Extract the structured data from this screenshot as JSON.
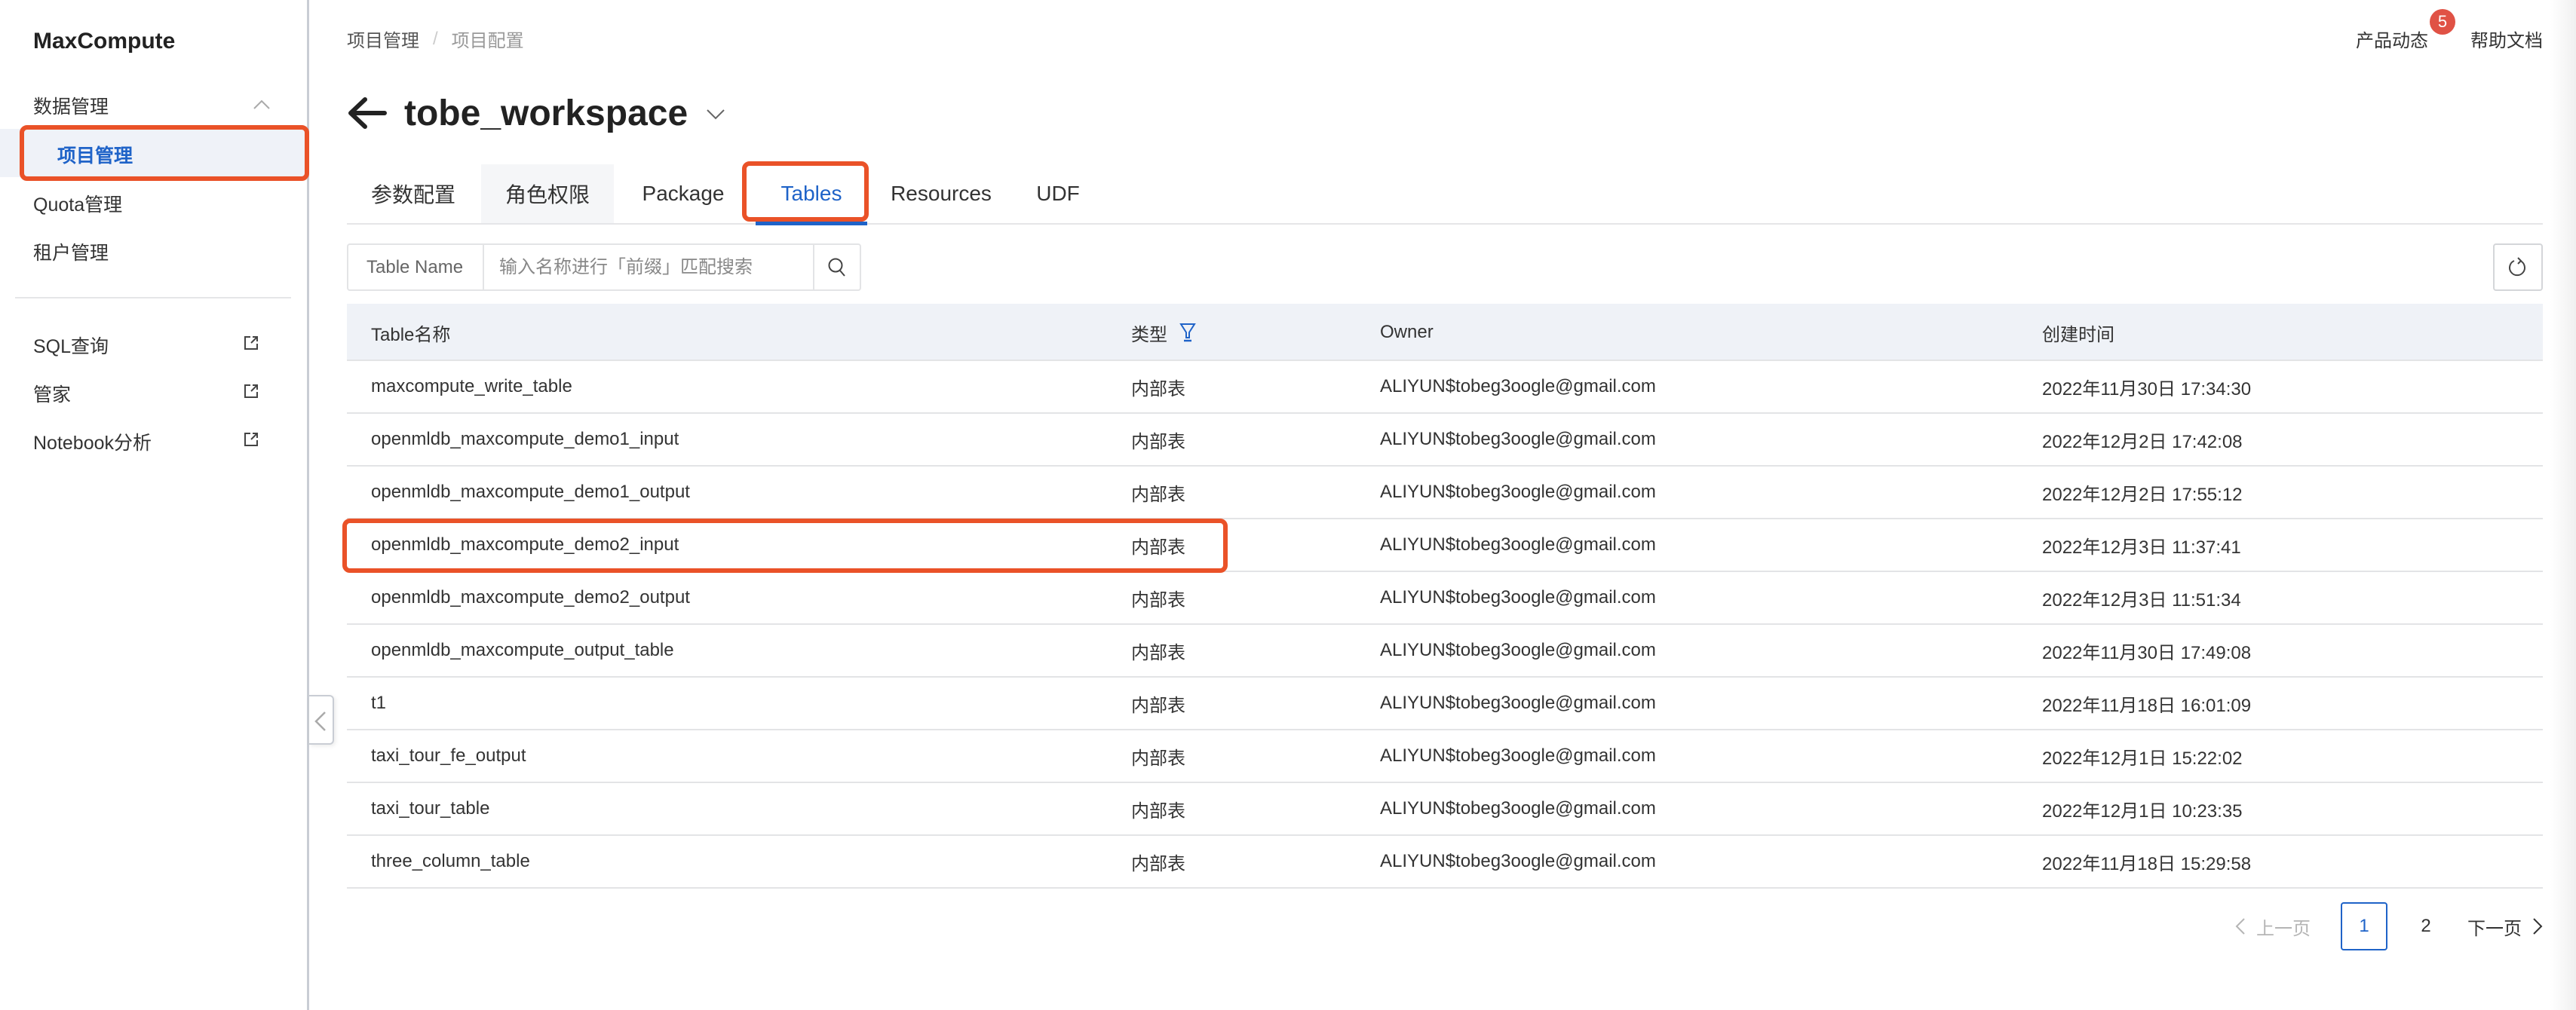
{
  "sidebar": {
    "brand": "MaxCompute",
    "group_label": "数据管理",
    "items": [
      {
        "label": "项目管理",
        "active": true
      },
      {
        "label": "Quota管理"
      },
      {
        "label": "租户管理"
      }
    ],
    "external_items": [
      {
        "label": "SQL查询",
        "icon": "external-link-icon"
      },
      {
        "label": "管家",
        "icon": "external-link-icon"
      },
      {
        "label": "Notebook分析",
        "icon": "external-link-icon"
      }
    ]
  },
  "topbar": {
    "product_news": "产品动态",
    "product_news_badge": "5",
    "help_docs": "帮助文档"
  },
  "breadcrumb": {
    "items": [
      "项目管理",
      "项目配置"
    ],
    "separator": "/"
  },
  "header": {
    "title": "tobe_workspace"
  },
  "tabs": [
    {
      "label": "参数配置"
    },
    {
      "label": "角色权限"
    },
    {
      "label": "Package"
    },
    {
      "label": "Tables",
      "active": true
    },
    {
      "label": "Resources"
    },
    {
      "label": "UDF"
    }
  ],
  "search": {
    "prefix_label": "Table Name",
    "placeholder": "输入名称进行「前缀」匹配搜索",
    "value": ""
  },
  "table": {
    "columns": [
      "Table名称",
      "类型",
      "Owner",
      "创建时间"
    ],
    "rows": [
      {
        "name": "maxcompute_write_table",
        "type": "内部表",
        "owner": "ALIYUN$tobeg3oogle@gmail.com",
        "created": "2022年11月30日 17:34:30"
      },
      {
        "name": "openmldb_maxcompute_demo1_input",
        "type": "内部表",
        "owner": "ALIYUN$tobeg3oogle@gmail.com",
        "created": "2022年12月2日 17:42:08"
      },
      {
        "name": "openmldb_maxcompute_demo1_output",
        "type": "内部表",
        "owner": "ALIYUN$tobeg3oogle@gmail.com",
        "created": "2022年12月2日 17:55:12"
      },
      {
        "name": "openmldb_maxcompute_demo2_input",
        "type": "内部表",
        "owner": "ALIYUN$tobeg3oogle@gmail.com",
        "created": "2022年12月3日 11:37:41"
      },
      {
        "name": "openmldb_maxcompute_demo2_output",
        "type": "内部表",
        "owner": "ALIYUN$tobeg3oogle@gmail.com",
        "created": "2022年12月3日 11:51:34"
      },
      {
        "name": "openmldb_maxcompute_output_table",
        "type": "内部表",
        "owner": "ALIYUN$tobeg3oogle@gmail.com",
        "created": "2022年11月30日 17:49:08"
      },
      {
        "name": "t1",
        "type": "内部表",
        "owner": "ALIYUN$tobeg3oogle@gmail.com",
        "created": "2022年11月18日 16:01:09"
      },
      {
        "name": "taxi_tour_fe_output",
        "type": "内部表",
        "owner": "ALIYUN$tobeg3oogle@gmail.com",
        "created": "2022年12月1日 15:22:02"
      },
      {
        "name": "taxi_tour_table",
        "type": "内部表",
        "owner": "ALIYUN$tobeg3oogle@gmail.com",
        "created": "2022年12月1日 10:23:35"
      },
      {
        "name": "three_column_table",
        "type": "内部表",
        "owner": "ALIYUN$tobeg3oogle@gmail.com",
        "created": "2022年11月18日 15:29:58"
      }
    ]
  },
  "pagination": {
    "prev_label": "上一页",
    "next_label": "下一页",
    "pages": [
      "1",
      "2"
    ],
    "current": "1"
  },
  "colors": {
    "accent": "#1f63c8",
    "annotation": "#ea5228",
    "badge": "#e05245",
    "table_header_bg": "#eff2f7",
    "sidebar_active_bg": "#eff2f8"
  }
}
